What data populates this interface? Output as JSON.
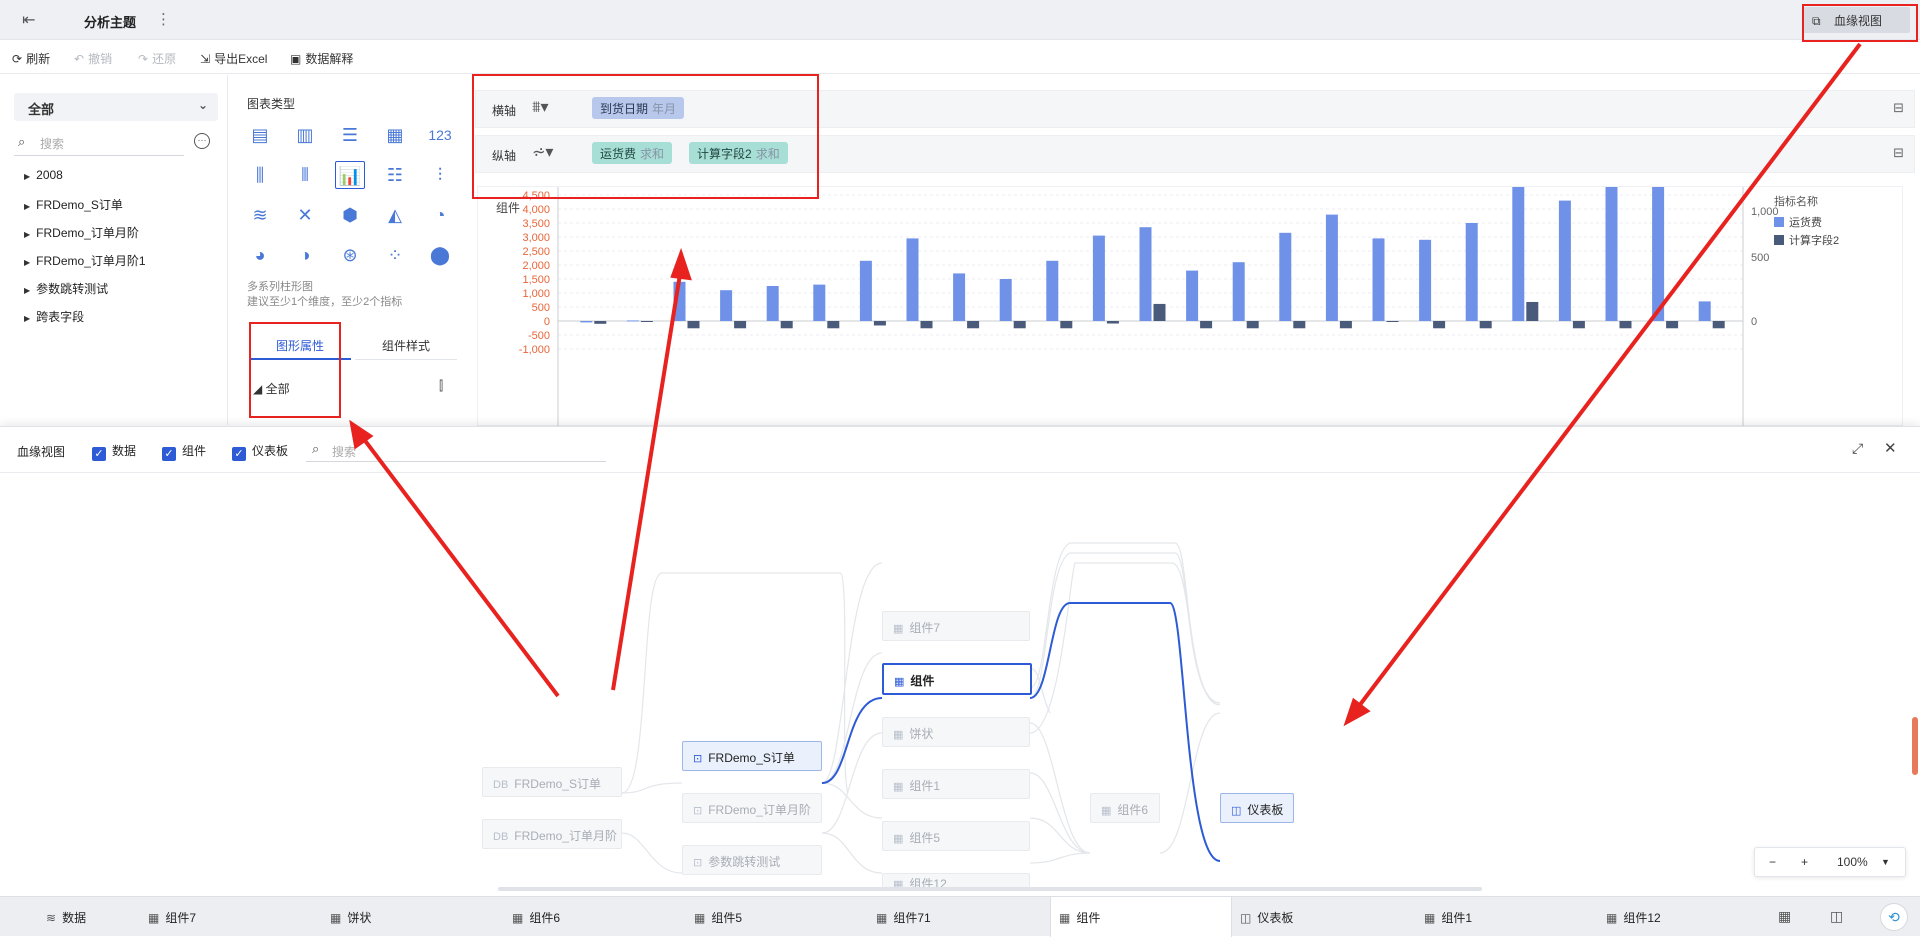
{
  "header": {
    "title": "分析主题",
    "lineage_button": "血缘视图"
  },
  "toolbar": {
    "refresh": "刷新",
    "undo": "撤销",
    "redo": "还原",
    "export_excel": "导出Excel",
    "data_explain": "数据解释"
  },
  "left_panel": {
    "scope": "全部",
    "search_placeholder": "搜索",
    "tree": [
      "2008",
      "FRDemo_S订单",
      "FRDemo_订单月阶",
      "FRDemo_订单月阶1",
      "参数跳转测试",
      "跨表字段"
    ]
  },
  "chart_type_panel": {
    "label": "图表类型",
    "selected_icon": "multi-series-bar-icon",
    "desc_line1": "多系列柱形图",
    "desc_line2": "建议至少1个维度，至少2个指标",
    "tab_shape": "图形属性",
    "tab_style": "组件样式",
    "all_node": "全部"
  },
  "axes": {
    "x_label": "横轴",
    "y_label": "纵轴",
    "x_chip": {
      "field": "到货日期",
      "agg": "年月"
    },
    "y_chips": [
      {
        "field": "运货费",
        "agg": "求和"
      },
      {
        "field": "计算字段2",
        "agg": "求和"
      }
    ]
  },
  "chart_data": {
    "type": "bar",
    "title": "组件",
    "legend_title": "指标名称",
    "legend_position": "right",
    "left_axis": {
      "ticks": [
        "5,000",
        "4,500",
        "4,000",
        "3,500",
        "3,000",
        "2,500",
        "2,000",
        "1,500",
        "1,000",
        "500",
        "0",
        "-500",
        "-1,000"
      ],
      "ylim": [
        -1000,
        5000
      ],
      "color": "#e8663a"
    },
    "right_axis": {
      "ticks": [
        "1,000",
        "500",
        "0"
      ]
    },
    "series": [
      {
        "name": "运货费",
        "color": "#6f92e8",
        "values": [
          -50,
          20,
          1400,
          1100,
          1250,
          1300,
          2150,
          2950,
          1700,
          1500,
          2150,
          3050,
          3350,
          1800,
          2100,
          3150,
          3800,
          2950,
          2900,
          3500,
          5000,
          4300,
          5500,
          5700,
          700
        ]
      },
      {
        "name": "计算字段2",
        "color": "#4a5a7a",
        "values": [
          -100,
          -30,
          -260,
          -260,
          -260,
          -260,
          -160,
          -260,
          -260,
          -260,
          -260,
          -90,
          610,
          -260,
          -260,
          -260,
          -260,
          -10,
          -260,
          -260,
          680,
          -260,
          -260,
          -260,
          -260
        ]
      }
    ]
  },
  "lineage": {
    "title": "血缘视图",
    "filters": [
      "数据",
      "组件",
      "仪表板"
    ],
    "search_placeholder": "搜索",
    "nodes": {
      "db1": "FRDemo_S订单",
      "db2": "FRDemo_订单月阶",
      "ds1": "FRDemo_S订单",
      "ds2": "FRDemo_订单月阶",
      "ds3": "参数跳转测试",
      "c7": "组件7",
      "c0": "组件",
      "cpie": "饼状",
      "c1": "组件1",
      "c5": "组件5",
      "c12": "组件12",
      "c6": "组件6",
      "dash": "仪表板"
    },
    "zoom": "100%"
  },
  "bottom_tabs": [
    "数据",
    "组件7",
    "饼状",
    "组件6",
    "组件5",
    "组件71",
    "组件",
    "仪表板",
    "组件1",
    "组件12"
  ],
  "selected_tab": "组件"
}
